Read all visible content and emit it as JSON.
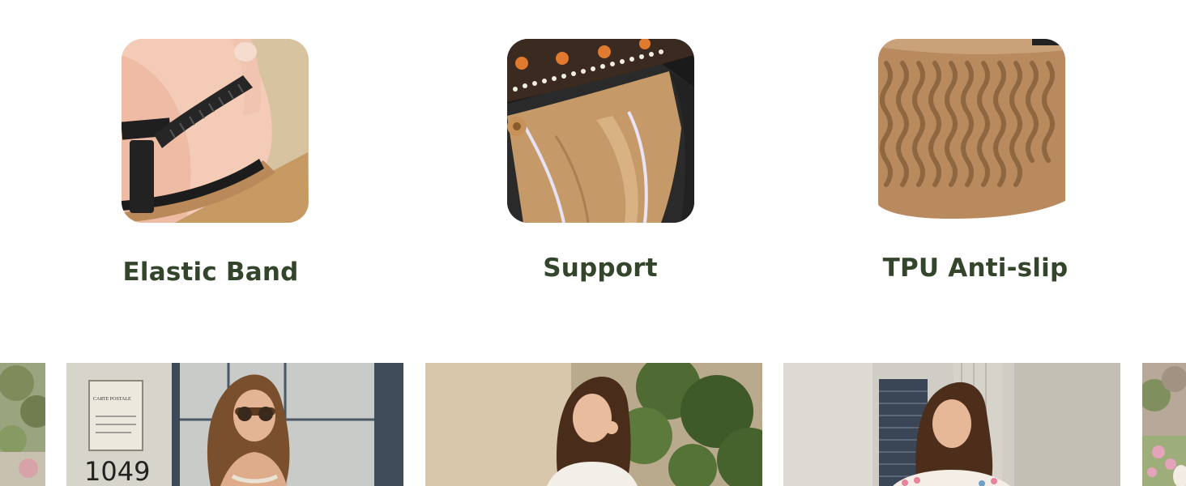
{
  "features": [
    {
      "label": "Elastic Band",
      "image": "heel-elastic-strap-photo"
    },
    {
      "label": "Support",
      "image": "cushioned-insole-photo"
    },
    {
      "label": "TPU Anti-slip",
      "image": "tpu-outsole-tread-photo"
    }
  ],
  "carousel": {
    "cards": [
      {
        "image": "peek-left-garden-photo"
      },
      {
        "image": "model-by-mailbox-photo",
        "mailbox_text": "CARTE POSTALE",
        "house_number": "1049"
      },
      {
        "image": "model-with-plants-photo"
      },
      {
        "image": "model-by-shutters-photo"
      },
      {
        "image": "peek-right-garden-photo"
      }
    ]
  }
}
